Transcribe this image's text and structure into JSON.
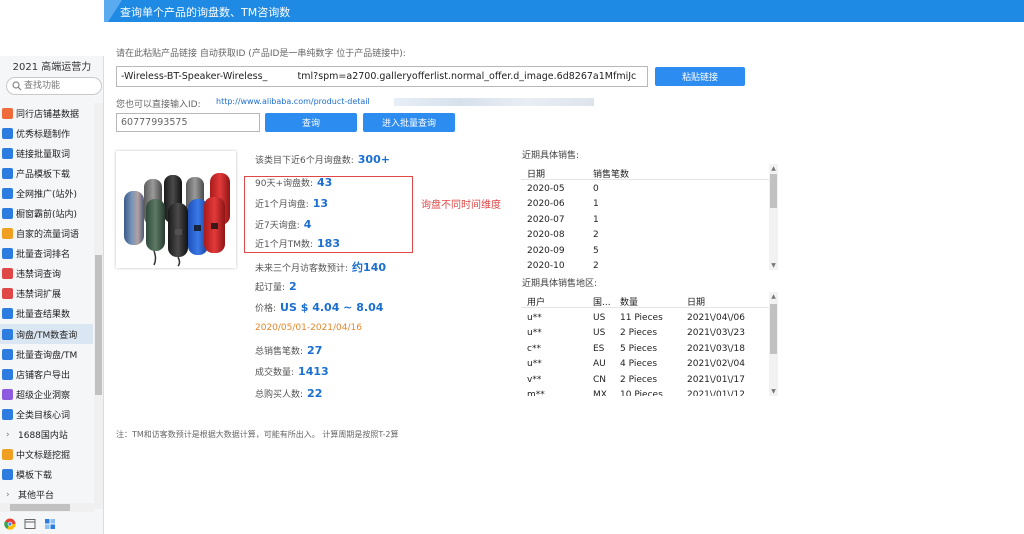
{
  "sidebar": {
    "title": "2021 高端运营力",
    "search_placeholder": "查找功能",
    "items": [
      {
        "label": "同行店铺基数据",
        "icon": "store-icon",
        "color": "#ef6b3a"
      },
      {
        "label": "优秀标题制作",
        "icon": "title-icon",
        "color": "#2d7de0"
      },
      {
        "label": "链接批量取词",
        "icon": "link-icon",
        "color": "#2d7de0"
      },
      {
        "label": "产品模板下载",
        "icon": "download-icon",
        "color": "#2d7de0"
      },
      {
        "label": "全网推广(站外)",
        "icon": "promote-icon",
        "color": "#2d7de0"
      },
      {
        "label": "橱窗霸前(站内)",
        "icon": "window-icon",
        "color": "#2d7de0"
      },
      {
        "label": "自家的流量词语",
        "icon": "traffic-icon",
        "color": "#f0a020"
      },
      {
        "label": "批量查词排名",
        "icon": "rank-icon",
        "color": "#2d7de0"
      },
      {
        "label": "违禁词查询",
        "icon": "forbidden-icon",
        "color": "#e04848"
      },
      {
        "label": "违禁词扩展",
        "icon": "forbidden-ext-icon",
        "color": "#e04848"
      },
      {
        "label": "批量查结果数",
        "icon": "result-icon",
        "color": "#2d7de0"
      },
      {
        "label": "询盘/TM数查询",
        "icon": "inquiry-icon",
        "color": "#2d7de0",
        "active": true
      },
      {
        "label": "批量查询盘/TM",
        "icon": "batch-inquiry-icon",
        "color": "#2d7de0"
      },
      {
        "label": "店铺客户导出",
        "icon": "export-icon",
        "color": "#2d7de0"
      },
      {
        "label": "超级企业洞察",
        "icon": "insight-icon",
        "color": "#8c5be0"
      },
      {
        "label": "全类目核心词",
        "icon": "keyword-icon",
        "color": "#2d7de0"
      }
    ],
    "group_1688": "1688国内站",
    "items_after": [
      {
        "label": "中文标题挖掘",
        "icon": "mining-icon",
        "color": "#f0a020"
      },
      {
        "label": "模板下载",
        "icon": "template-icon",
        "color": "#2d7de0"
      }
    ],
    "group_other": "其他平台"
  },
  "header": {
    "title": "查询单个产品的询盘数、TM咨询数"
  },
  "main": {
    "paste_hint": "请在此粘贴产品链接 自动获取ID (产品ID是一串纯数字 位于产品链接中):",
    "url_value": "-Wireless-BT-Speaker-Wireless_          tml?spm=a2700.galleryofferlist.normal_offer.d_image.6d8267a1MfmiJc",
    "paste_button": "粘贴链接",
    "id_hint": "您也可以直接输入ID:",
    "id_link": "http://www.alibaba.com/product-detail",
    "id_value": "60777993575",
    "query_button": "查询",
    "batch_button": "进入批量查询",
    "info": {
      "category_label": "该类目下近6个月询盘数:",
      "category_value": "300+",
      "d90_label": "90天+询盘数:",
      "d90_value": "43",
      "m1_label": "近1个月询盘:",
      "m1_value": "13",
      "d7_label": "近7天询盘:",
      "d7_value": "4",
      "tm_label": "近1个月TM数:",
      "tm_value": "183",
      "visitors_label": "未来三个月访客数预计:",
      "visitors_value": "约140",
      "moq_label": "起订量:",
      "moq_value": "2",
      "price_label": "价格:",
      "price_value": "US $ 4.04 ~ 8.04",
      "date_range": "2020/05/01-2021/04/16",
      "sales_label": "总销售笔数:",
      "sales_value": "27",
      "volume_label": "成交数量:",
      "volume_value": "1413",
      "buyers_label": "总购买人数:",
      "buyers_value": "22"
    },
    "highlight_note": "询盘不同时间维度",
    "sales_table": {
      "title": "近期具体销售:",
      "headers": [
        "日期",
        "销售笔数"
      ],
      "rows": [
        [
          "2020-05",
          "0"
        ],
        [
          "2020-06",
          "1"
        ],
        [
          "2020-07",
          "1"
        ],
        [
          "2020-08",
          "2"
        ],
        [
          "2020-09",
          "5"
        ],
        [
          "2020-10",
          "2"
        ]
      ]
    },
    "region_table": {
      "title": "近期具体销售地区:",
      "headers": [
        "用户",
        "国...",
        "数量",
        "日期"
      ],
      "rows": [
        [
          "u**",
          "US",
          "11 Pieces",
          "2021\\/04\\/06"
        ],
        [
          "u**",
          "US",
          "2 Pieces",
          "2021\\/03\\/23"
        ],
        [
          "c**",
          "ES",
          "5 Pieces",
          "2021\\/03\\/18"
        ],
        [
          "u**",
          "AU",
          "4 Pieces",
          "2021\\/02\\/04"
        ],
        [
          "v**",
          "CN",
          "2 Pieces",
          "2021\\/01\\/17"
        ],
        [
          "m**",
          "MX",
          "10 Pieces",
          "2021\\/01\\/12"
        ]
      ]
    },
    "footnote": "注：TM和访客数预计是根据大数据计算，可能有所出入。     计算周期是按照T-2算"
  }
}
